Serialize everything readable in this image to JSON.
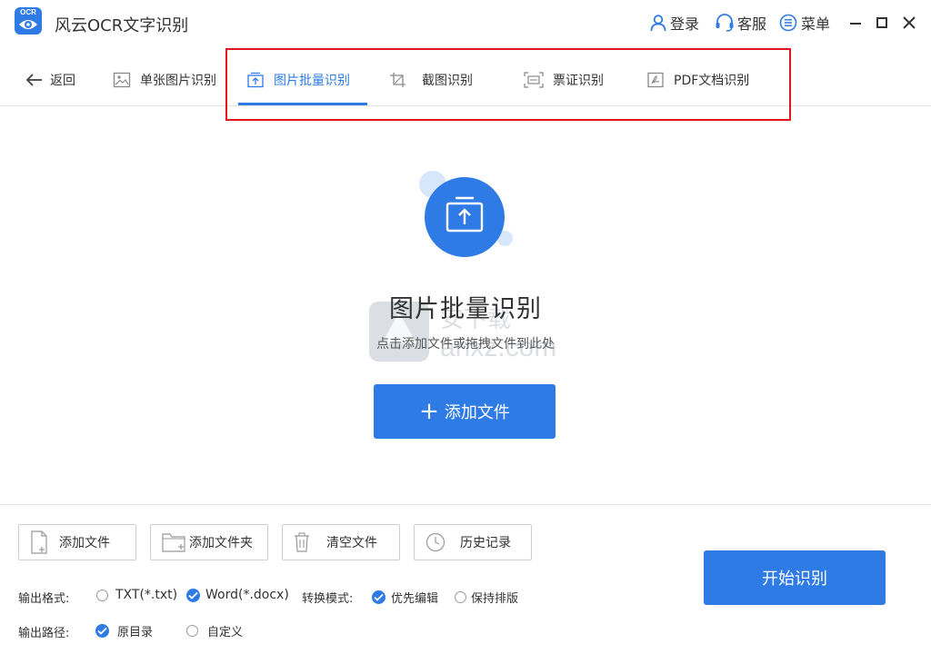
{
  "app": {
    "title": "风云OCR文字识别",
    "logo_text": "OCR"
  },
  "titlebar": {
    "login": "登录",
    "service": "客服",
    "menu": "菜单"
  },
  "back_label": "返回",
  "tabs": [
    {
      "label": "单张图片识别",
      "icon": "image-icon"
    },
    {
      "label": "图片批量识别",
      "icon": "upload-icon",
      "active": true
    },
    {
      "label": "截图识别",
      "icon": "crop-icon"
    },
    {
      "label": "票证识别",
      "icon": "scan-icon"
    },
    {
      "label": "PDF文档识别",
      "icon": "pdf-icon"
    }
  ],
  "dropzone": {
    "title": "图片批量识别",
    "hint": "点击添加文件或拖拽文件到此处",
    "add_button": "添加文件"
  },
  "toolbar": {
    "add_file": "添加文件",
    "add_folder": "添加文件夹",
    "clear": "清空文件",
    "history": "历史记录"
  },
  "options": {
    "output_format_label": "输出格式:",
    "formats": [
      {
        "label": "TXT(*.txt)",
        "checked": false
      },
      {
        "label": "Word(*.docx)",
        "checked": true
      }
    ],
    "convert_mode_label": "转换模式:",
    "modes": [
      {
        "label": "优先编辑",
        "checked": true
      },
      {
        "label": "保持排版",
        "checked": false
      }
    ],
    "output_path_label": "输出路径:",
    "paths": [
      {
        "label": "原目录",
        "checked": true
      },
      {
        "label": "自定义",
        "checked": false
      }
    ]
  },
  "start_button": "开始识别",
  "watermark": "安下载 anxz.com",
  "colors": {
    "accent": "#2f7be6",
    "highlight": "#e0161d",
    "bubble": "#d8e6fb"
  }
}
